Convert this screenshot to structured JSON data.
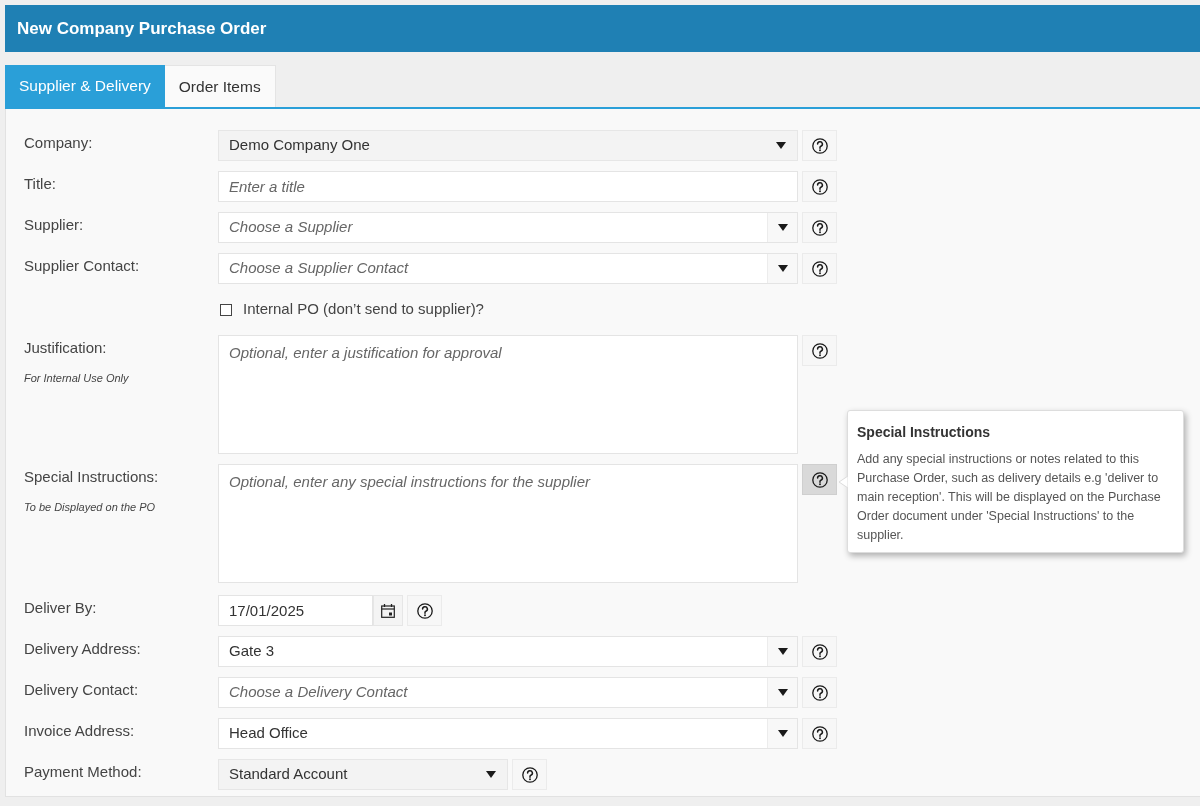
{
  "window": {
    "title": "New Company Purchase Order"
  },
  "tabs": [
    {
      "label": "Supplier & Delivery",
      "selected": true
    },
    {
      "label": "Order Items",
      "selected": false
    }
  ],
  "form": {
    "fields": [
      {
        "kind": "select",
        "label": "Company:",
        "value": "Demo Company One",
        "compact": false,
        "help_open": false
      },
      {
        "kind": "text",
        "label": "Title:",
        "placeholder": "Enter a title",
        "help_open": false
      },
      {
        "kind": "combobox",
        "label": "Supplier:",
        "placeholder": "Choose a Supplier",
        "help_open": false
      },
      {
        "kind": "combobox",
        "label": "Supplier Contact:",
        "placeholder": "Choose a Supplier Contact",
        "help_open": false
      },
      {
        "kind": "checkbox",
        "label": "Internal PO (don’t send to supplier)?",
        "checked": false
      },
      {
        "kind": "textarea",
        "label": "Justification:",
        "hint": "For Internal Use Only",
        "placeholder": "Optional, enter a justification for approval",
        "help_open": false
      },
      {
        "kind": "textarea",
        "label": "Special Instructions:",
        "hint": "To be Displayed on the PO",
        "placeholder": "Optional, enter any special instructions for the supplier",
        "help_open": true
      },
      {
        "kind": "date",
        "label": "Deliver By:",
        "value": "17/01/2025",
        "help_open": false
      },
      {
        "kind": "combobox",
        "label": "Delivery Address:",
        "value": "Gate 3",
        "help_open": false
      },
      {
        "kind": "combobox",
        "label": "Delivery Contact:",
        "placeholder": "Choose a Delivery Contact",
        "help_open": false
      },
      {
        "kind": "combobox",
        "label": "Invoice Address:",
        "value": "Head Office",
        "help_open": false
      },
      {
        "kind": "select",
        "label": "Payment Method:",
        "value": "Standard Account",
        "compact": true,
        "help_open": false
      }
    ]
  },
  "tooltip": {
    "title": "Special Instructions",
    "text": "Add any special instructions or notes related to this Purchase Order, such as delivery details e.g 'deliver to main reception'. This will be displayed on the Purchase Order document under 'Special Instructions' to the supplier."
  }
}
